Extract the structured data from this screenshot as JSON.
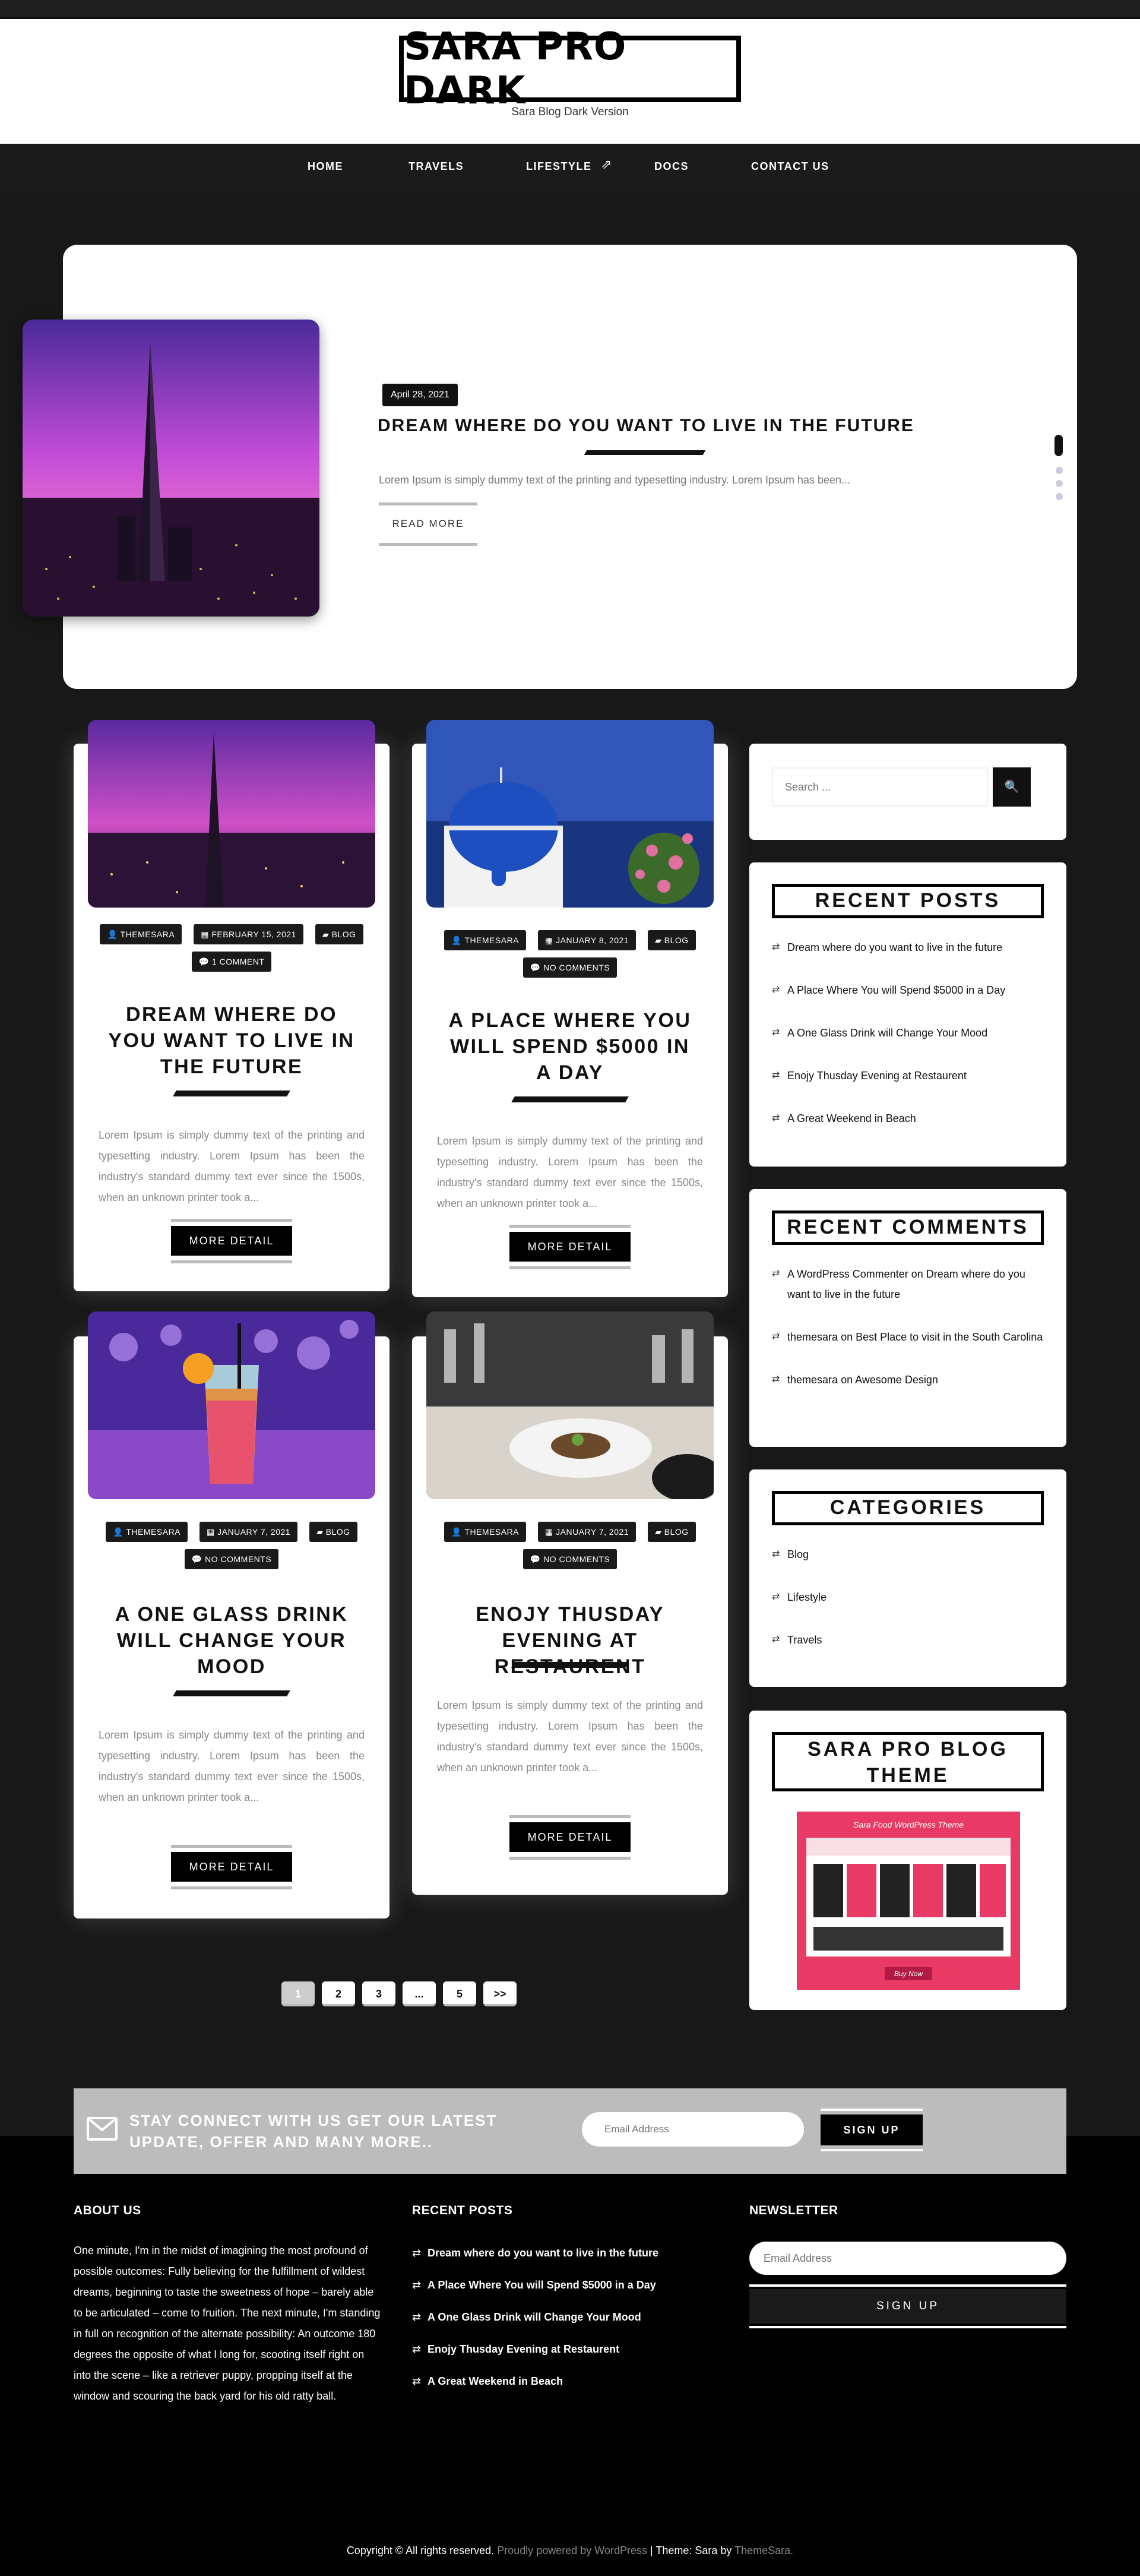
{
  "site": {
    "title": "SARA PRO DARK",
    "tagline": "Sara Blog Dark Version"
  },
  "nav": {
    "items": [
      "HOME",
      "TRAVELS",
      "LIFESTYLE",
      "DOCS",
      "CONTACT US"
    ]
  },
  "slider": {
    "date": "April 28, 2021",
    "title": "DREAM WHERE DO YOU WANT TO LIVE IN THE FUTURE",
    "excerpt": "Lorem Ipsum is simply dummy text of the printing and typesetting industry. Lorem Ipsum has been...",
    "read_more": "READ MORE"
  },
  "posts": [
    {
      "author": "THEMESARA",
      "date": "FEBRUARY 15, 2021",
      "category": "BLOG",
      "comments": "1 COMMENT",
      "title": "DREAM WHERE DO YOU WANT TO LIVE IN THE FUTURE",
      "excerpt": "Lorem Ipsum is simply dummy text of the printing and typesetting industry. Lorem Ipsum has been the industry's standard dummy text ever since the 1500s, when an unknown printer took a...",
      "more": "MORE DETAIL"
    },
    {
      "author": "THEMESARA",
      "date": "JANUARY 8, 2021",
      "category": "BLOG",
      "comments": "NO COMMENTS",
      "title": "A PLACE WHERE YOU WILL SPEND $5000 IN A DAY",
      "excerpt": "Lorem Ipsum is simply dummy text of the printing and typesetting industry. Lorem Ipsum has been the industry's standard dummy text ever since the 1500s, when an unknown printer took a...",
      "more": "MORE DETAIL"
    },
    {
      "author": "THEMESARA",
      "date": "JANUARY 7, 2021",
      "category": "BLOG",
      "comments": "NO COMMENTS",
      "title": "A ONE GLASS DRINK WILL CHANGE YOUR MOOD",
      "excerpt": "Lorem Ipsum is simply dummy text of the printing and typesetting industry. Lorem Ipsum has been the industry's standard dummy text ever since the 1500s, when an unknown printer took a...",
      "more": "MORE DETAIL"
    },
    {
      "author": "THEMESARA",
      "date": "JANUARY 7, 2021",
      "category": "BLOG",
      "comments": "NO COMMENTS",
      "title": "ENOJY THUSDAY EVENING AT RESTAURENT",
      "excerpt": "Lorem Ipsum is simply dummy text of the printing and typesetting industry. Lorem Ipsum has been the industry's standard dummy text ever since the 1500s, when an unknown printer took a...",
      "more": "MORE DETAIL"
    }
  ],
  "sidebar": {
    "search_placeholder": "Search ...",
    "recent_posts": {
      "title": "RECENT POSTS",
      "items": [
        "Dream where do you want to live in the future",
        "A Place Where You will Spend $5000 in a Day",
        "A One Glass Drink will Change Your Mood",
        "Enojy Thusday Evening at Restaurent",
        "A Great Weekend in Beach"
      ]
    },
    "recent_comments": {
      "title": "RECENT COMMENTS",
      "items": [
        {
          "author": "A WordPress Commenter",
          "on": "on",
          "post": "Dream where do you want to live in the future"
        },
        {
          "author": "themesara",
          "on": "on",
          "post": "Best Place to visit in the South Carolina"
        },
        {
          "author": "themesara",
          "on": "on",
          "post": "Awesome Design"
        }
      ]
    },
    "categories": {
      "title": "CATEGORIES",
      "items": [
        "Blog",
        "Lifestyle",
        "Travels"
      ]
    },
    "pro_theme": {
      "title": "SARA PRO BLOG THEME",
      "banner_title": "Sara Food WordPress Theme",
      "banner_button": "Buy Now"
    }
  },
  "pagination": {
    "pages": [
      "1",
      "2",
      "3",
      "...",
      "5",
      ">>"
    ],
    "current": "1"
  },
  "subscribe": {
    "text": "STAY CONNECT WITH US GET OUR LATEST UPDATE, OFFER AND MANY MORE..",
    "placeholder": "Email Address",
    "button": "SIGN UP"
  },
  "footer": {
    "about_title": "ABOUT US",
    "about_text": "One minute, I'm in the midst of imagining the most profound of possible outcomes: Fully believing for the fulfillment of wildest dreams, beginning to taste the sweetness of hope – barely able to be articulated – come to fruition. The next minute, I'm standing in full on recognition of the alternate possibility: An outcome 180 degrees the opposite of what I long for, scooting itself right on into the scene – like a retriever puppy, propping itself at the window and scouring the back yard for his old ratty ball.",
    "recent_title": "RECENT POSTS",
    "recent_items": [
      "Dream where do you want to live in the future",
      "A Place Where You will Spend $5000 in a Day",
      "A One Glass Drink will Change Your Mood",
      "Enojy Thusday Evening at Restaurent",
      "A Great Weekend in Beach"
    ],
    "newsletter_title": "NEWSLETTER",
    "newsletter_placeholder": "Email Address",
    "newsletter_button": "SIGN UP"
  },
  "copyright": {
    "prefix": "Copyright © All rights reserved.",
    "powered": "Proudly powered by WordPress",
    "sep": "| Theme: Sara by",
    "themesara": "ThemeSara."
  }
}
